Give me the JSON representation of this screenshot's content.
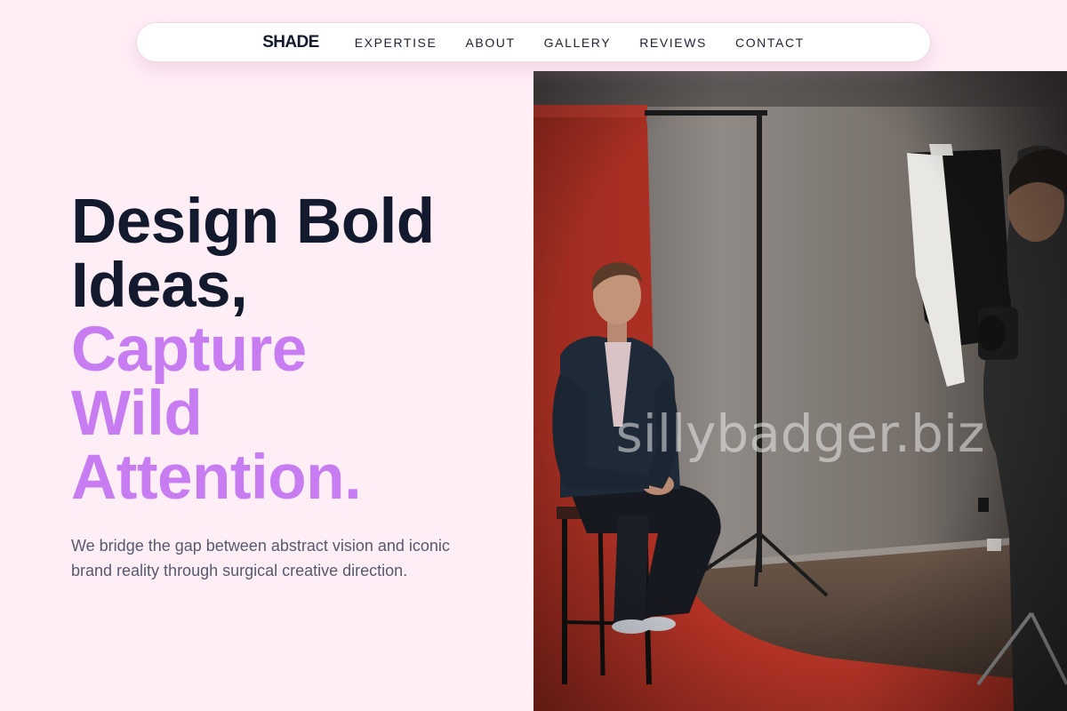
{
  "nav": {
    "logo": "SHADE",
    "links": [
      "EXPERTISE",
      "ABOUT",
      "GALLERY",
      "REVIEWS",
      "CONTACT"
    ]
  },
  "hero": {
    "headline_dark": [
      "Design Bold",
      "Ideas,"
    ],
    "headline_accent": [
      "Capture",
      "Wild",
      "Attention."
    ],
    "subtext": "We bridge the gap between abstract vision and iconic brand reality through surgical creative direction."
  },
  "image": {
    "watermark": "sillybadger.biz",
    "description": "photo-studio-portrait"
  },
  "colors": {
    "background": "#ffeef6",
    "headline_dark": "#141a2e",
    "headline_accent": "#c77cf2",
    "subtext": "#555a6e"
  }
}
